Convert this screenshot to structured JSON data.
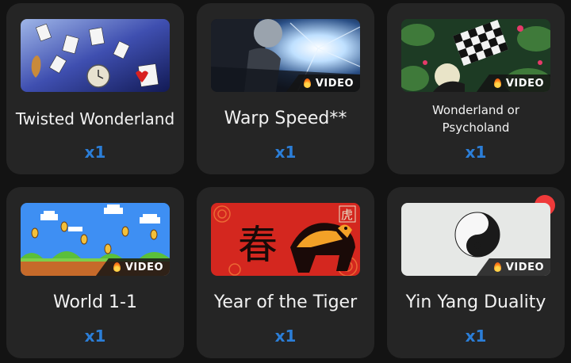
{
  "cards": [
    {
      "title": "Twisted Wonderland",
      "quantity": "x1",
      "badge": ""
    },
    {
      "title": "Warp Speed**",
      "quantity": "x1",
      "badge": "VIDEO"
    },
    {
      "title": "Wonderland or Psycholand",
      "quantity": "x1",
      "badge": "VIDEO"
    },
    {
      "title": "World 1-1",
      "quantity": "x1",
      "badge": "VIDEO"
    },
    {
      "title": "Year of the Tiger",
      "quantity": "x1",
      "badge": ""
    },
    {
      "title": "Yin Yang Duality",
      "quantity": "x1",
      "badge": "VIDEO"
    }
  ],
  "thumbnail_labels": {
    "tiger_char": "春",
    "tiger_stamp": "虎"
  },
  "icons": {
    "badge_icon": "fire-icon",
    "notification": "notification-dot"
  },
  "colors": {
    "page_bg": "#131313",
    "card_bg": "#252525",
    "quantity": "#2b7ed8",
    "notification": "#ef3a3a"
  }
}
